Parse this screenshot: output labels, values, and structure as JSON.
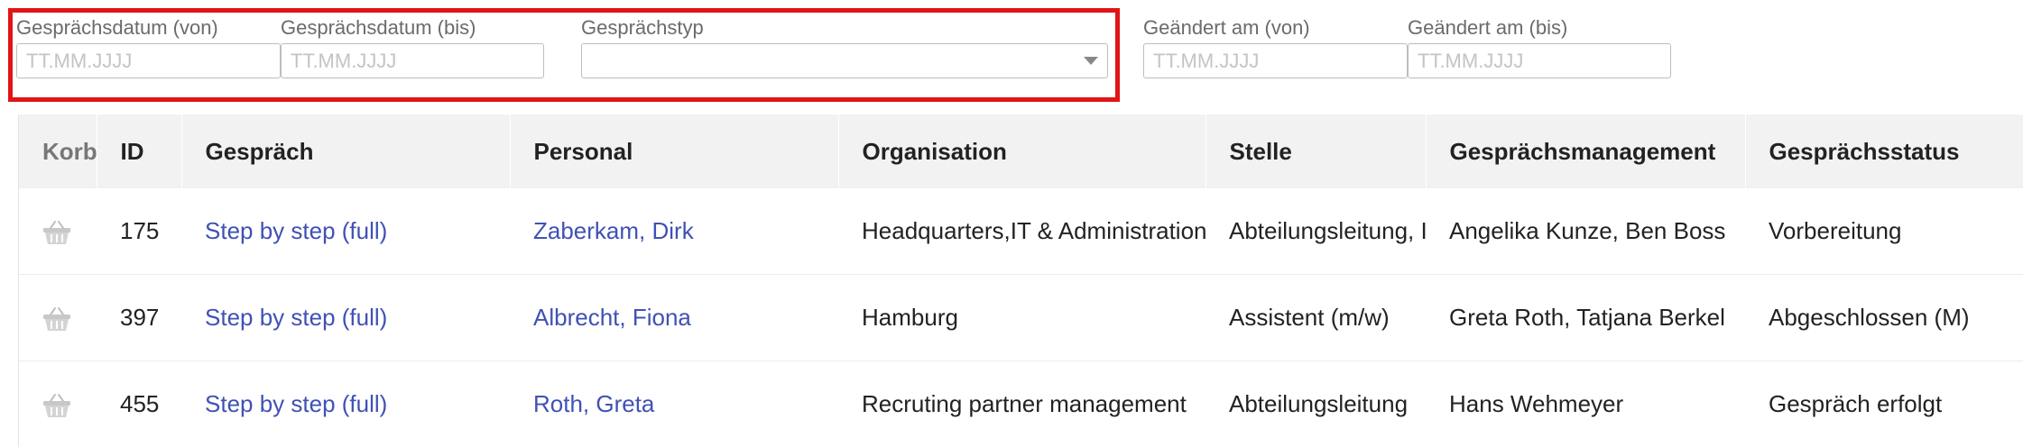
{
  "filters": {
    "gespraechsdatum_von": {
      "label": "Gesprächsdatum (von)",
      "placeholder": "TT.MM.JJJJ",
      "value": ""
    },
    "gespraechsdatum_bis": {
      "label": "Gesprächsdatum (bis)",
      "placeholder": "TT.MM.JJJJ",
      "value": ""
    },
    "gespraechstyp": {
      "label": "Gesprächstyp",
      "value": ""
    },
    "geaendert_von": {
      "label": "Geändert am (von)",
      "placeholder": "TT.MM.JJJJ",
      "value": ""
    },
    "geaendert_bis": {
      "label": "Geändert am (bis)",
      "placeholder": "TT.MM.JJJJ",
      "value": ""
    }
  },
  "table": {
    "headers": [
      "Korb",
      "ID",
      "Gespräch",
      "Personal",
      "Organisation",
      "Stelle",
      "Gesprächsmanagement",
      "Gesprächsstatus"
    ],
    "rows": [
      {
        "id": "175",
        "gespraech": "Step by step (full)",
        "personal": "Zaberkam, Dirk",
        "organisation": "Headquarters,IT & Administration",
        "stelle": "Abteilungsleitung, IT",
        "management": "Angelika Kunze, Ben Boss",
        "status": "Vorbereitung"
      },
      {
        "id": "397",
        "gespraech": "Step by step (full)",
        "personal": "Albrecht, Fiona",
        "organisation": "Hamburg",
        "stelle": "Assistent (m/w)",
        "management": "Greta Roth, Tatjana Berkel",
        "status": "Abgeschlossen (M)"
      },
      {
        "id": "455",
        "gespraech": "Step by step (full)",
        "personal": "Roth, Greta",
        "organisation": "Recruting partner management",
        "stelle": "Abteilungsleitung",
        "management": "Hans Wehmeyer",
        "status": "Gespräch erfolgt"
      }
    ]
  },
  "icons": {
    "basket": "basket-icon",
    "dropdown": "chevron-down-icon"
  },
  "colors": {
    "highlight": "#e01515",
    "link": "#3f51b5"
  }
}
